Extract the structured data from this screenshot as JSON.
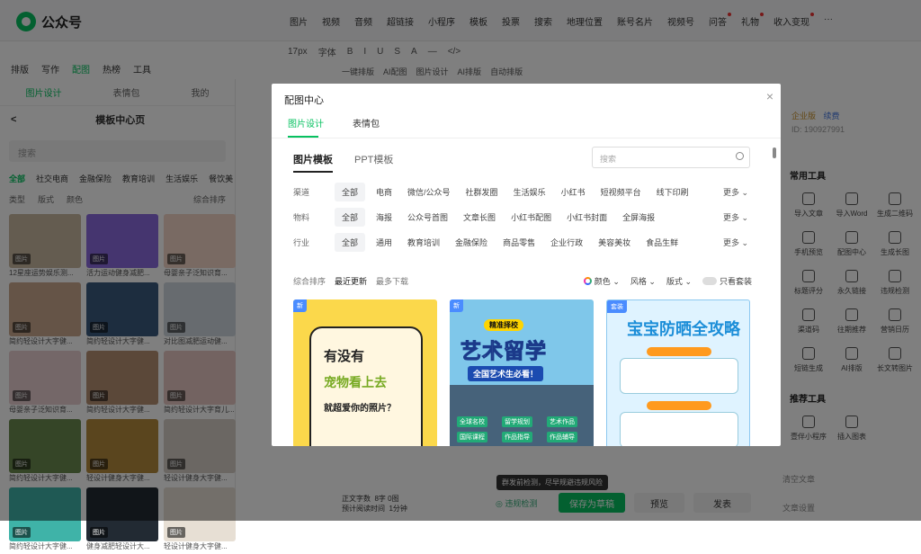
{
  "app": {
    "name": "公众号"
  },
  "menu": [
    "图片",
    "视频",
    "音频",
    "超链接",
    "小程序",
    "模板",
    "投票",
    "搜索",
    "地理位置",
    "账号名片",
    "视频号",
    "问答",
    "礼物",
    "收入变现",
    "···"
  ],
  "toolbar2": [
    "17px",
    "字体",
    "B",
    "I",
    "U",
    "S",
    "A",
    "—",
    "</>"
  ],
  "toolbar3": [
    "一键排版",
    "AI配图",
    "图片设计",
    "AI排版",
    "自动排版"
  ],
  "topTabs": [
    "排版",
    "写作",
    "配图",
    "热榜",
    "工具"
  ],
  "sidebar": {
    "tabs": [
      "图片设计",
      "表情包",
      "我的"
    ],
    "title": "模板中心页",
    "search_placeholder": "搜索",
    "categories": [
      "全部",
      "社交电商",
      "金融保险",
      "教育培训",
      "生活娱乐",
      "餐饮美"
    ],
    "filters": [
      "类型",
      "版式",
      "颜色",
      "综合排序"
    ],
    "thumbs": [
      {
        "cap": "12星座运势娱乐测...",
        "color": "#c9b8a0",
        "badge": "图片"
      },
      {
        "cap": "活力运动健身减肥...",
        "color": "#8a6adf",
        "badge": "图片"
      },
      {
        "cap": "母婴亲子泛知识育...",
        "color": "#f2d4c6",
        "badge": "图片"
      },
      {
        "cap": "简约轻设计大字健...",
        "color": "#caa88e",
        "badge": "图片"
      },
      {
        "cap": "简约轻设计大字健...",
        "color": "#3b5a7e",
        "badge": "图片"
      },
      {
        "cap": "对比图减肥运动健...",
        "color": "#cfd7de",
        "badge": "图片"
      },
      {
        "cap": "母婴亲子泛知识育...",
        "color": "#e9cfd0",
        "badge": "图片"
      },
      {
        "cap": "简约轻设计大字健...",
        "color": "#b79073",
        "badge": "图片"
      },
      {
        "cap": "简约轻设计大字育儿...",
        "color": "#e7c7c2",
        "badge": "图片"
      },
      {
        "cap": "简约轻设计大字健...",
        "color": "#6b8a4f",
        "badge": "图片"
      },
      {
        "cap": "轻设计健身大字健...",
        "color": "#b58b3d",
        "badge": "图片"
      },
      {
        "cap": "轻设计健身大字健...",
        "color": "#d6cfc6",
        "badge": "图片"
      },
      {
        "cap": "简约轻设计大字健...",
        "color": "#3fb3a8",
        "badge": "图片"
      },
      {
        "cap": "健身减肥轻设计大...",
        "color": "#222a33",
        "badge": "图片"
      },
      {
        "cap": "轻设计健身大字健...",
        "color": "#e7dfd4",
        "badge": "图片"
      }
    ]
  },
  "rightPanel": {
    "account_badge": "企业版",
    "account_link": "续费",
    "account_id": "ID: 190927991",
    "common_tools_title": "常用工具",
    "tools": [
      "导入文章",
      "导入Word",
      "生成二维码",
      "手机预览",
      "配图中心",
      "生成长图",
      "标题评分",
      "永久链接",
      "违规检测",
      "渠道码",
      "往期推荐",
      "营销日历",
      "短链生成",
      "AI排版",
      "长文转图片"
    ],
    "recommend_title": "推荐工具",
    "recommend": [
      "壹伴小程序",
      "插入图表"
    ],
    "bottom": [
      "清空文章",
      "文章设置"
    ]
  },
  "modal": {
    "title": "配图中心",
    "tabs": [
      "图片设计",
      "表情包"
    ],
    "subtabs": [
      "图片模板",
      "PPT模板"
    ],
    "search_placeholder": "搜索",
    "close": "×",
    "rows": [
      {
        "label": "渠道",
        "options": [
          "全部",
          "电商",
          "微信/公众号",
          "社群发圈",
          "生活娱乐",
          "小红书",
          "短视频平台",
          "线下印刷"
        ],
        "more": "更多"
      },
      {
        "label": "物料",
        "options": [
          "全部",
          "海报",
          "公众号首图",
          "文章长图",
          "小红书配图",
          "小红书封面",
          "全屏海报"
        ],
        "more": "更多"
      },
      {
        "label": "行业",
        "options": [
          "全部",
          "通用",
          "教育培训",
          "金融保险",
          "商品零售",
          "企业行政",
          "美容美妆",
          "食品生鲜"
        ],
        "more": "更多"
      }
    ],
    "sort": [
      "综合排序",
      "最近更新",
      "最多下载"
    ],
    "sort_right": [
      "颜色",
      "风格",
      "版式",
      "只看套装"
    ],
    "cards": [
      {
        "tag": "新",
        "lines": [
          "有没有",
          "宠物看上去",
          "就超爱你的照片？"
        ]
      },
      {
        "tag": "新",
        "header": "精准择校",
        "big": "艺术留学",
        "band": "全国艺术生必看！",
        "checks": [
          "全球名校",
          "留学规划",
          "艺术作品",
          "国际课程",
          "作品指导",
          "作品辅导"
        ]
      },
      {
        "tag": "套装",
        "title": "宝宝防晒全攻略"
      }
    ]
  },
  "footer": {
    "warn": "群发前检测，尽早规避违规风险",
    "stats_label1": "正文字数",
    "stats_value1": "8字 0图",
    "stats_label2": "预计阅读时间",
    "stats_value2": "1分钟",
    "check": "违规检测",
    "save": "保存为草稿",
    "preview": "预览",
    "publish": "发表"
  }
}
